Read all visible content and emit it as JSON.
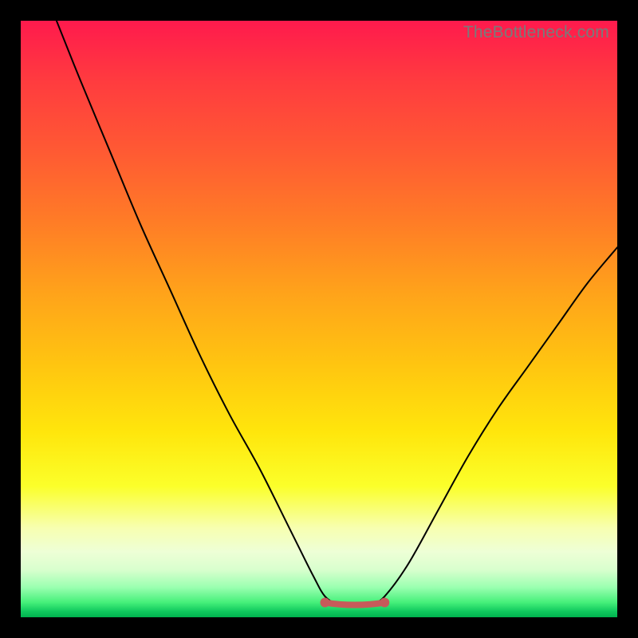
{
  "watermark": "TheBottleneck.com",
  "chart_data": {
    "type": "line",
    "title": "",
    "xlabel": "",
    "ylabel": "",
    "xlim": [
      0,
      100
    ],
    "ylim": [
      0,
      100
    ],
    "series": [
      {
        "name": "bottleneck-curve",
        "x": [
          6,
          10,
          15,
          20,
          25,
          30,
          35,
          40,
          45,
          49,
          51,
          53,
          55,
          57,
          59,
          61,
          65,
          70,
          75,
          80,
          85,
          90,
          95,
          100
        ],
        "values": [
          100,
          90,
          78,
          66,
          55,
          44,
          34,
          25,
          15,
          7,
          3.5,
          2.3,
          2.0,
          2.0,
          2.3,
          3.5,
          9,
          18,
          27,
          35,
          42,
          49,
          56,
          62
        ]
      }
    ],
    "valley_marker": {
      "x_start": 51,
      "x_end": 61,
      "y": 2.2,
      "color": "#c75a5a"
    }
  }
}
